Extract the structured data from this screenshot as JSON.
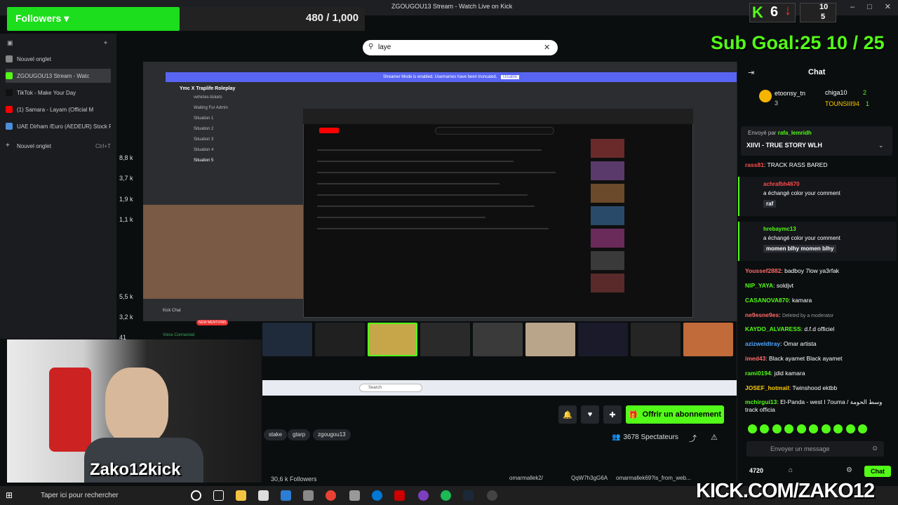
{
  "window": {
    "title": "ZGOUGOU13 Stream - Watch Live on Kick"
  },
  "overlay": {
    "followers_label": "Followers ▾",
    "followers_progress": "480 / 1,000",
    "sub_goal": "Sub Goal:25 10 / 25",
    "kick_rank": "6",
    "stat_a": "10",
    "stat_b": "5",
    "webcam_name": "Zako12kick",
    "kick_url": "KICK.COM/ZAKO12",
    "viewer_counts": [
      "8,8 k",
      "3,7 k",
      "1,9 k",
      "1,1 k",
      "5,5 k",
      "3,2 k",
      "41"
    ]
  },
  "tabs": [
    {
      "label": "Nouvel onglet",
      "color": "#888888"
    },
    {
      "label": "ZGOUGOU13 Stream - Watc",
      "color": "#53fc18"
    },
    {
      "label": "TikTok - Make Your Day",
      "color": "#111111"
    },
    {
      "label": "(1) Samara - Layam (Official M",
      "color": "#ff0000"
    },
    {
      "label": "UAE Dirham /Euro (AEDEUR) Stock P",
      "color": "#4a90d9"
    },
    {
      "label": "Nouvel onglet",
      "shortcut": "Ctrl+T"
    }
  ],
  "search": {
    "value": "laye"
  },
  "discord": {
    "streamer_notice": "Streamer Mode is enabled. Usernames have been truncated.",
    "disable_label": "Disable",
    "server_name": "Ymc X Traplife Roleplay",
    "channels": [
      "vehicles-tickets",
      "Waiting For Admin",
      "Situation 1",
      "Situation 2",
      "Situation 3",
      "Situation 4",
      "Situation 5"
    ],
    "voice_status": "Voice Connected",
    "kick_chat": "Kick Chat",
    "new_mentions": "NEW MENTIONS"
  },
  "stream": {
    "subscribe_label": "Offrir un abonnement",
    "tags": [
      "stake",
      "gtarp",
      "zgougou13"
    ],
    "spectators": "3678 Spectateurs",
    "followers": "30,6 k Followers",
    "socials": [
      "omarmallek2/",
      "QqW7h3gG6A",
      "omarmallek69?is_from_web..."
    ]
  },
  "chat": {
    "title": "Chat",
    "top_gifters": [
      {
        "name": "etoonsy_tn",
        "count": "3"
      },
      {
        "name": "chiga10",
        "count": "2"
      },
      {
        "name": "TOUNSIII94",
        "count": "1"
      }
    ],
    "pinned": {
      "sent_by_prefix": "Envoyé par",
      "sender": "rafa_lemridh",
      "message": "XIIVI - TRUE STORY WLH"
    },
    "messages": [
      {
        "user": "rass81",
        "text": "TRACK RASS BARED",
        "color": "#ff4d4d"
      },
      {
        "user": "Youssef2882",
        "text": "badboy 7low ya3rfak",
        "color": "#ff6b6b"
      },
      {
        "user": "NIP_YAYA",
        "text": "soldjvt",
        "color": "#53fc18"
      },
      {
        "user": "CASANOVA870",
        "text": "kamara",
        "color": "#53fc18"
      },
      {
        "user": "ne9esne9es",
        "text": "Deleted by a moderator",
        "color": "#ff6b6b"
      },
      {
        "user": "KAYDO_ALVARESS",
        "text": "d.f.d officiel",
        "color": "#53fc18"
      },
      {
        "user": "azizweldtray",
        "text": "Omar artista",
        "color": "#4da6ff"
      },
      {
        "user": "imed43",
        "text": "Black ayamet Black ayamet",
        "color": "#ff6b6b"
      },
      {
        "user": "rami0194",
        "text": "jdid kamara",
        "color": "#53fc18"
      },
      {
        "user": "JOSEF_hotmail",
        "text": "Twinshood ektbb",
        "color": "#ffcc00"
      },
      {
        "user": "mchirgui13",
        "text": "El-Panda - west l 7ouma / وسط الحومة track officia",
        "color": "#53fc18"
      }
    ],
    "events": [
      {
        "user": "achrafbh4670",
        "action": "a échangé color your comment",
        "value": "raf"
      },
      {
        "user": "hrebaymc13",
        "action": "a échangé color your comment",
        "value": "momen blhy momen blhy"
      }
    ],
    "input_placeholder": "Envoyer un message",
    "points": "4720",
    "send_label": "Chat"
  },
  "taskbar": {
    "search_placeholder": "Taper ici pour rechercher"
  }
}
